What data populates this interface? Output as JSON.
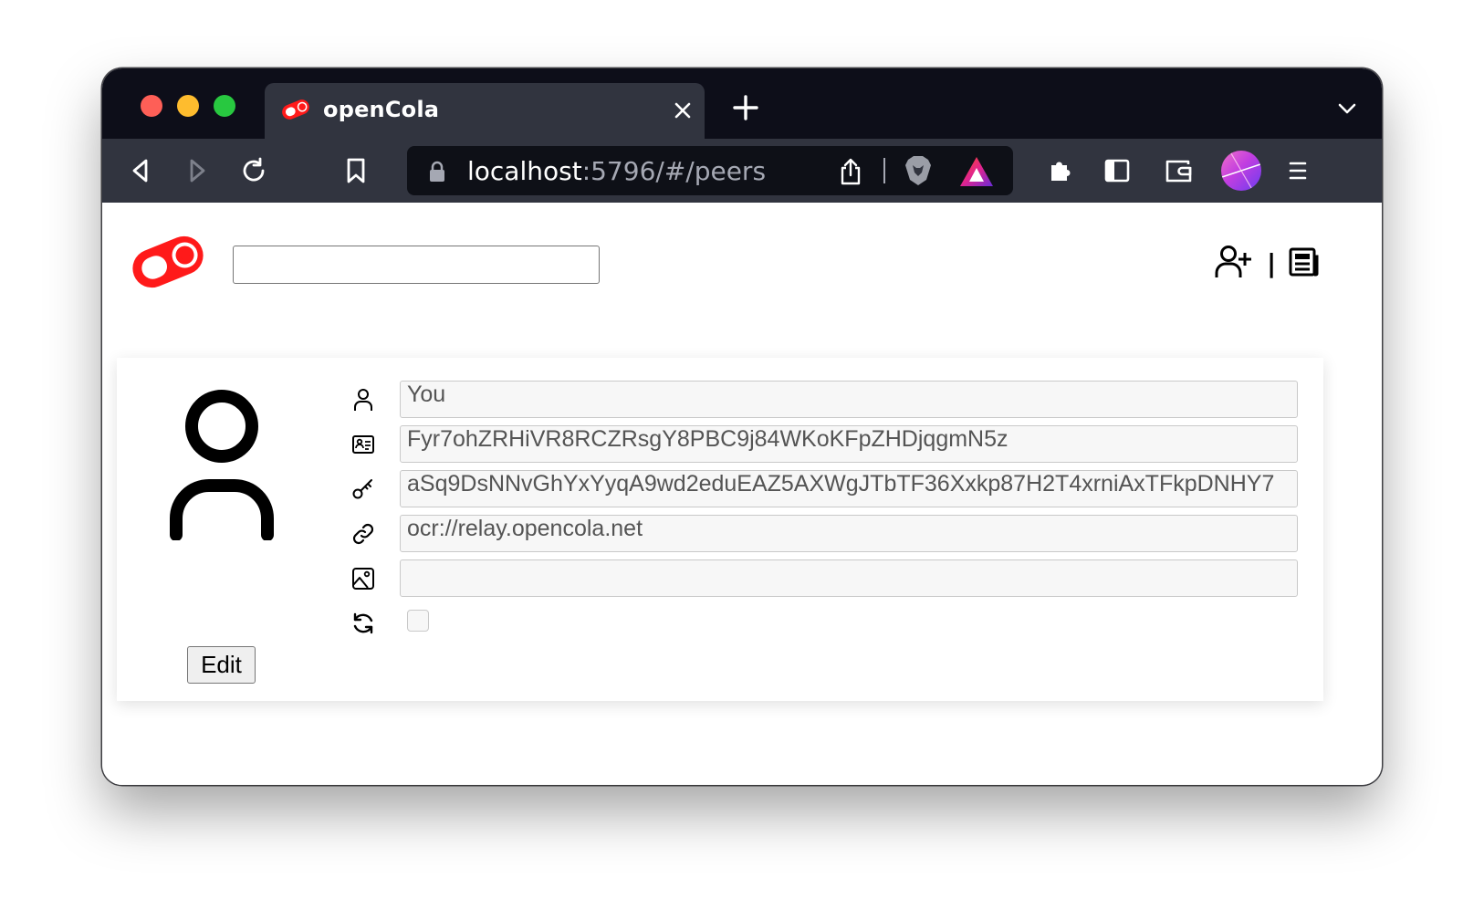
{
  "browser": {
    "tab": {
      "title": "openCola"
    },
    "url": {
      "host": "localhost",
      "rest": ":5796/#/peers"
    },
    "icons": [
      "back-icon",
      "forward-icon",
      "reload-icon",
      "bookmark-icon",
      "lock-icon",
      "share-icon",
      "brave-shields-icon",
      "brave-rewards-icon",
      "extensions-icon",
      "sidebar-icon",
      "wallet-icon",
      "profile-avatar-icon",
      "menu-icon"
    ]
  },
  "header": {
    "search": {
      "value": "",
      "placeholder": ""
    },
    "separator": "|",
    "icons": [
      "add-peer-icon",
      "feed-icon"
    ]
  },
  "profile": {
    "name": "You",
    "id": "Fyr7ohZRHiVR8RCZRsgY8PBC9j84WKoKFpZHDjqgmN5z",
    "public_key": "aSq9DsNNvGhYxYyqA9wd2eduEAZ5AXWgJTbTF36Xxkp87H2T4xrniAxTFkpDNHY7",
    "address": "ocr://relay.opencola.net",
    "image_uri": "",
    "sync_checked": false,
    "edit_label": "Edit"
  },
  "colors": {
    "brand": "#ff1a1a",
    "chrome_dark": "#0d0e19",
    "toolbar": "#31343f"
  }
}
